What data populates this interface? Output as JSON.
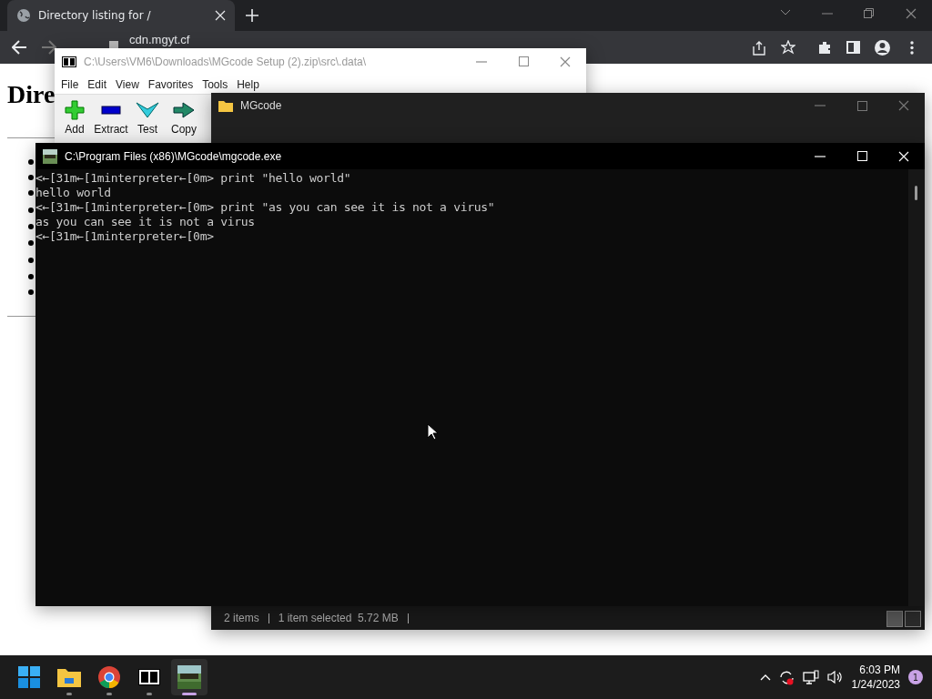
{
  "browser": {
    "tabs": [
      {
        "title": "Directory listing for /",
        "selected": true
      }
    ],
    "url": "cdn.mgyt.cf",
    "heading": "Dire"
  },
  "archiver": {
    "title": "C:\\Users\\VM6\\Downloads\\MGcode Setup (2).zip\\src\\.data\\",
    "menu": [
      "File",
      "Edit",
      "View",
      "Favorites",
      "Tools",
      "Help"
    ],
    "tools": [
      {
        "kind": "add",
        "label": "Add"
      },
      {
        "kind": "extract",
        "label": "Extract"
      },
      {
        "kind": "test",
        "label": "Test"
      },
      {
        "kind": "copy",
        "label": "Copy"
      }
    ]
  },
  "explorer": {
    "title": "MGcode",
    "status": [
      "2 items",
      "1 item selected  5.72 MB"
    ]
  },
  "console": {
    "title": "C:\\Program Files (x86)\\MGcode\\mgcode.exe",
    "lines": [
      "<←[31m←[1minterpreter←[0m> print \"hello world\"",
      "hello world",
      "<←[31m←[1minterpreter←[0m> print \"as you can see it is not a virus\"",
      "as you can see it is not a virus",
      "<←[31m←[1minterpreter←[0m>"
    ]
  },
  "taskbar": {
    "apps": [
      {
        "kind": "start",
        "selected": false
      },
      {
        "kind": "files",
        "selected": false
      },
      {
        "kind": "browser",
        "selected": false
      },
      {
        "kind": "archiver",
        "selected": false
      },
      {
        "kind": "mgcode",
        "selected": true
      }
    ],
    "time": "6:03 PM",
    "date": "1/24/2023",
    "notifications": "1"
  }
}
